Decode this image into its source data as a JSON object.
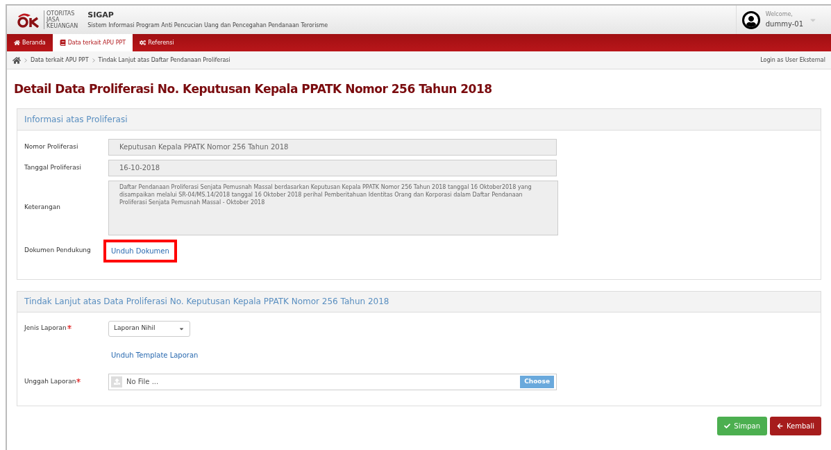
{
  "header": {
    "logo_text": [
      "OTORITAS",
      "JASA",
      "KEUANGAN"
    ],
    "app_name": "SIGAP",
    "app_subtitle": "Sistem Informasi Program Anti Pencucian Uang dan Pencegahan Pendanaan Terorisme",
    "welcome": "Welcome,",
    "username": "dummy-01"
  },
  "nav": [
    {
      "label": "Beranda",
      "selected": false
    },
    {
      "label": "Data terkait APU PPT",
      "selected": true
    },
    {
      "label": "Referensi",
      "selected": false
    }
  ],
  "breadcrumb": [
    "Data terkait APU PPT",
    "Tindak Lanjut atas Daftar Pendanaan Proliferasi"
  ],
  "login_as": "Login as User Eksternal",
  "page_title": "Detail Data Proliferasi No. Keputusan Kepala PPATK Nomor 256 Tahun 2018",
  "info_panel": {
    "title": "Informasi atas Proliferasi",
    "fields": [
      {
        "kind": "input",
        "label": "Nomor Proliferasi",
        "value": "Keputusan Kepala PPATK Nomor 256 Tahun 2018"
      },
      {
        "kind": "input",
        "label": "Tanggal Proliferasi",
        "value": "16-10-2018"
      },
      {
        "kind": "textarea",
        "label": "Keterangan",
        "value": "Daftar Pendanaan Proliferasi Senjata Pemusnah Massal berdasarkan Keputusan Kepala PPATK Nomor 256 Tahun 2018 tanggal 16 Oktober2018 yang disampaikan melalui SR-04/MS.14/2018 tanggal 16 Oktober 2018 perihal Pemberitahuan Identitas Orang dan Korporasi dalam Daftar Pendanaan Proliferasi Senjata Pemusnah Massal - Oktober 2018"
      },
      {
        "kind": "link",
        "label": "Dokumen Pendukung",
        "value": "Unduh Dokumen",
        "highlighted": true
      }
    ]
  },
  "followup_panel": {
    "title": "Tindak Lanjut atas Data Proliferasi No. Keputusan Kepala PPATK Nomor 256 Tahun 2018",
    "fields": [
      {
        "kind": "select",
        "label": "Jenis Laporan",
        "required": true,
        "value": "Laporan Nihil"
      },
      {
        "kind": "link",
        "value": "Unduh Template Laporan",
        "highlighted": false
      },
      {
        "kind": "file",
        "label": "Unggah Laporan",
        "required": true,
        "placeholder": "No File ...",
        "button": "Choose"
      }
    ]
  },
  "buttons": [
    {
      "label": "Simpan",
      "kind": "save"
    },
    {
      "label": "Kembali",
      "kind": "back"
    }
  ]
}
